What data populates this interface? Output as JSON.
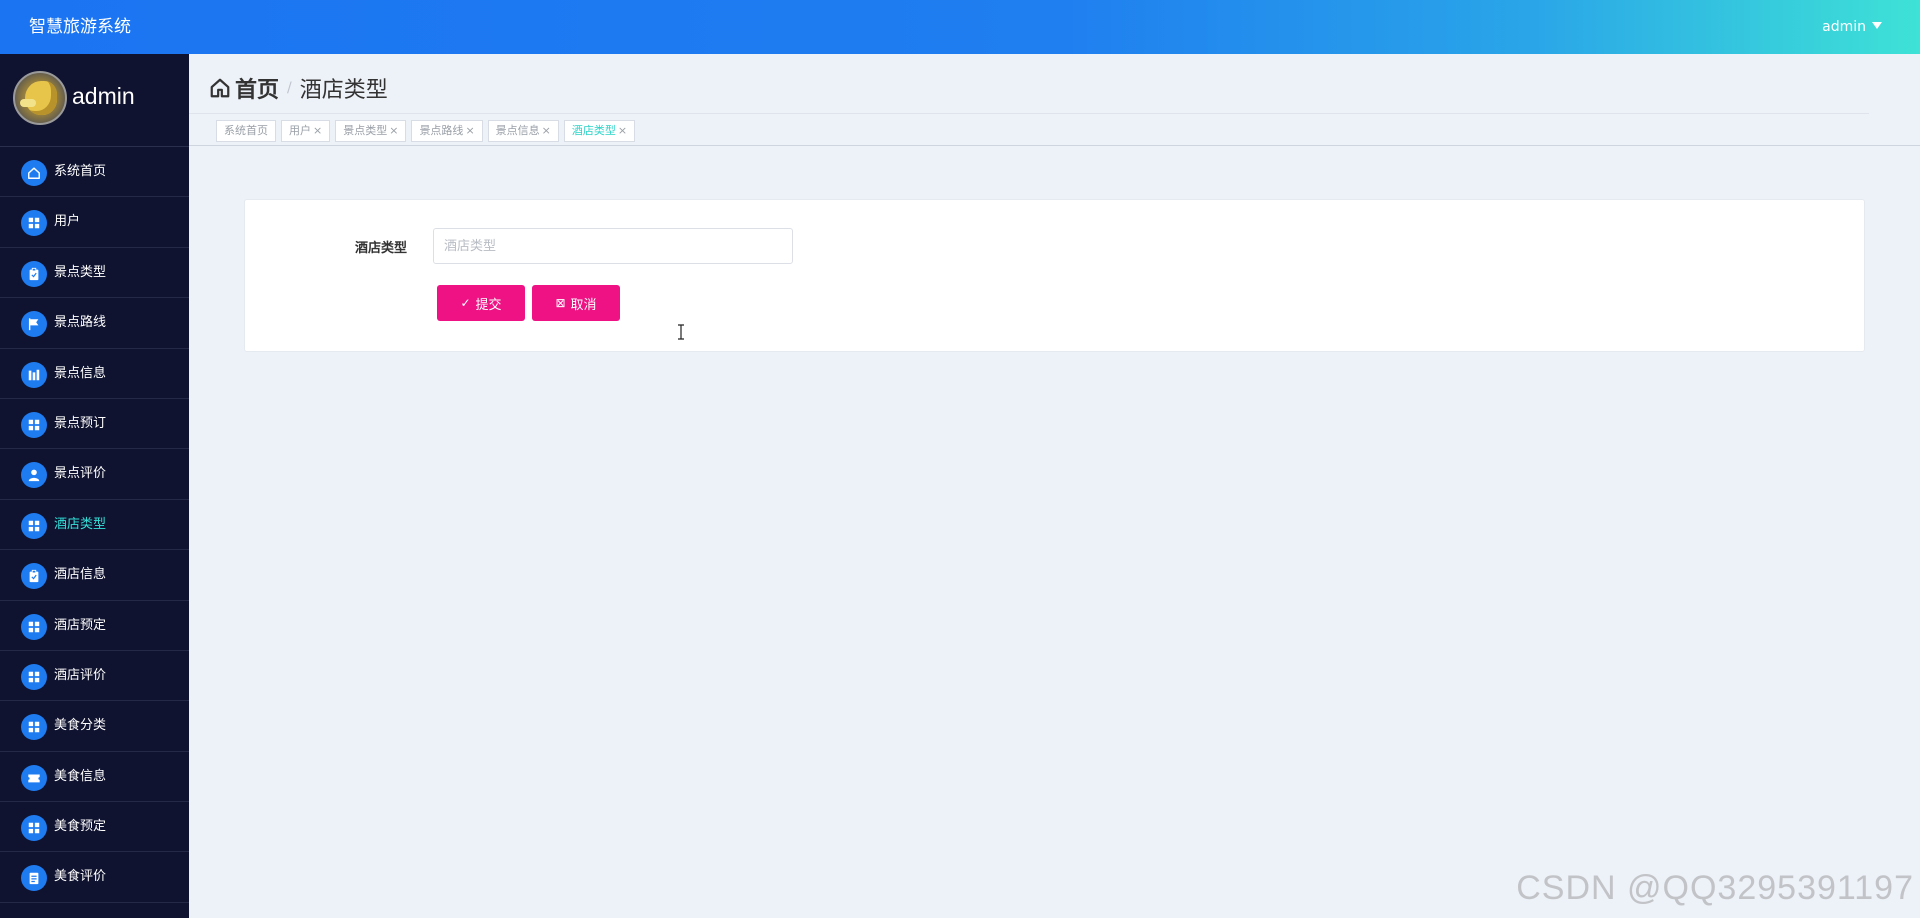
{
  "app": {
    "title": "智慧旅游系统"
  },
  "user": {
    "menu_label": "admin",
    "profile_name": "admin"
  },
  "sidebar": {
    "items": [
      {
        "label": "系统首页",
        "icon": "home-icon",
        "active": false
      },
      {
        "label": "用户",
        "icon": "grid-icon",
        "active": false
      },
      {
        "label": "景点类型",
        "icon": "clipboard-icon",
        "active": false
      },
      {
        "label": "景点路线",
        "icon": "flag-icon",
        "active": false
      },
      {
        "label": "景点信息",
        "icon": "chart-icon",
        "active": false
      },
      {
        "label": "景点预订",
        "icon": "grid-icon",
        "active": false
      },
      {
        "label": "景点评价",
        "icon": "user-icon",
        "active": false
      },
      {
        "label": "酒店类型",
        "icon": "grid-icon",
        "active": true
      },
      {
        "label": "酒店信息",
        "icon": "clipboard-icon",
        "active": false
      },
      {
        "label": "酒店预定",
        "icon": "grid-icon",
        "active": false
      },
      {
        "label": "酒店评价",
        "icon": "grid-icon",
        "active": false
      },
      {
        "label": "美食分类",
        "icon": "grid-icon",
        "active": false
      },
      {
        "label": "美食信息",
        "icon": "ticket-icon",
        "active": false
      },
      {
        "label": "美食预定",
        "icon": "grid-icon",
        "active": false
      },
      {
        "label": "美食评价",
        "icon": "document-icon",
        "active": false
      }
    ]
  },
  "breadcrumb": {
    "home": "首页",
    "separator": "/",
    "current": "酒店类型"
  },
  "tags": [
    {
      "label": "系统首页",
      "closable": false,
      "active": false
    },
    {
      "label": "用户",
      "closable": true,
      "active": false
    },
    {
      "label": "景点类型",
      "closable": true,
      "active": false
    },
    {
      "label": "景点路线",
      "closable": true,
      "active": false
    },
    {
      "label": "景点信息",
      "closable": true,
      "active": false
    },
    {
      "label": "酒店类型",
      "closable": true,
      "active": true
    }
  ],
  "form": {
    "field_label": "酒店类型",
    "input_value": "",
    "input_placeholder": "酒店类型",
    "submit_label": "提交",
    "cancel_label": "取消"
  },
  "colors": {
    "accent_button": "#ee1284",
    "active_menu_text": "#33e0d8",
    "sidebar_bg": "#0f1330",
    "icon_bg": "#1f7bf0"
  },
  "watermark": "CSDN @QQ3295391197"
}
